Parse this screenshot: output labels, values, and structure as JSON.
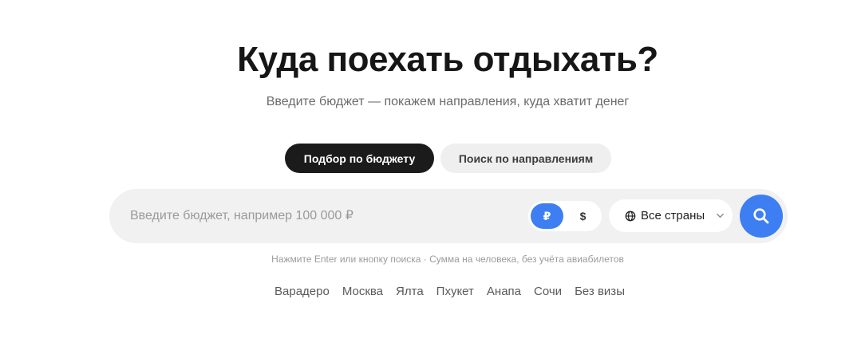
{
  "hero": {
    "title": "Куда поехать отдыхать?",
    "subtitle": "Введите бюджет — покажем направления, куда хватит денег"
  },
  "tabs": [
    {
      "label": "Подбор по бюджету",
      "active": true
    },
    {
      "label": "Поиск по направлениям",
      "active": false
    }
  ],
  "search": {
    "placeholder": "Введите бюджет, например 100 000 ₽",
    "value": "",
    "currencies": [
      {
        "label": "₽",
        "active": true
      },
      {
        "label": "$",
        "active": false
      }
    ],
    "country_label": "Все страны",
    "country_icon": "globe-icon",
    "chevron_icon": "chevron-down-icon",
    "submit_icon": "search-icon"
  },
  "hint": "Нажмите Enter или кнопку поиска · Сумма на человека, без учёта авиабилетов",
  "suggestions": [
    "Варадеро",
    "Москва",
    "Ялта",
    "Пхукет",
    "Анапа",
    "Сочи",
    "Без визы"
  ],
  "colors": {
    "accent": "#3d7ff2",
    "dark": "#1b1b1b",
    "bar_bg": "#f1f1f1"
  }
}
